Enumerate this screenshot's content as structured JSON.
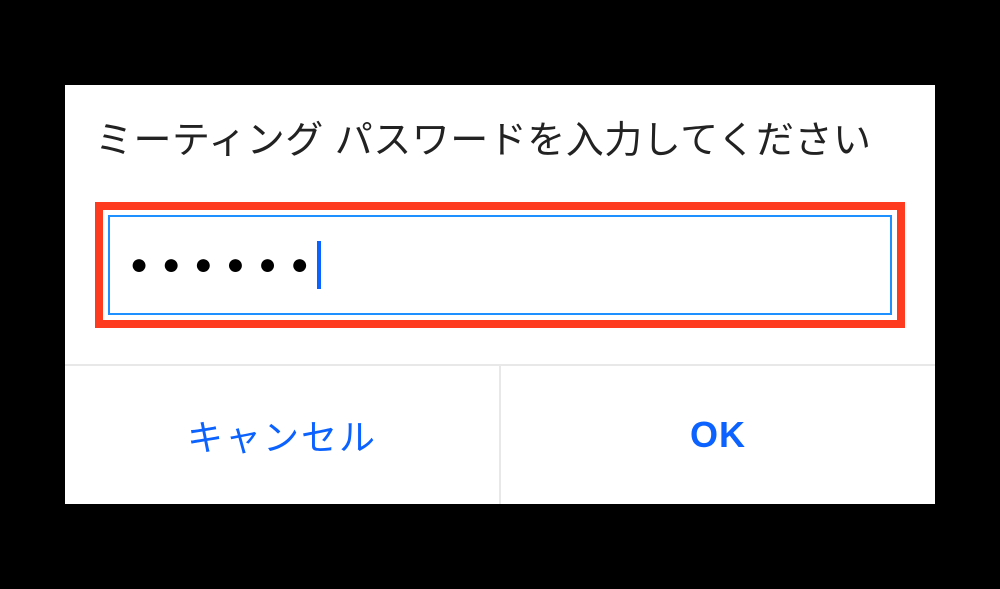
{
  "dialog": {
    "title": "ミーティング パスワードを入力してください",
    "password_mask": "●●●●●●",
    "buttons": {
      "cancel": "キャンセル",
      "ok": "OK"
    }
  }
}
